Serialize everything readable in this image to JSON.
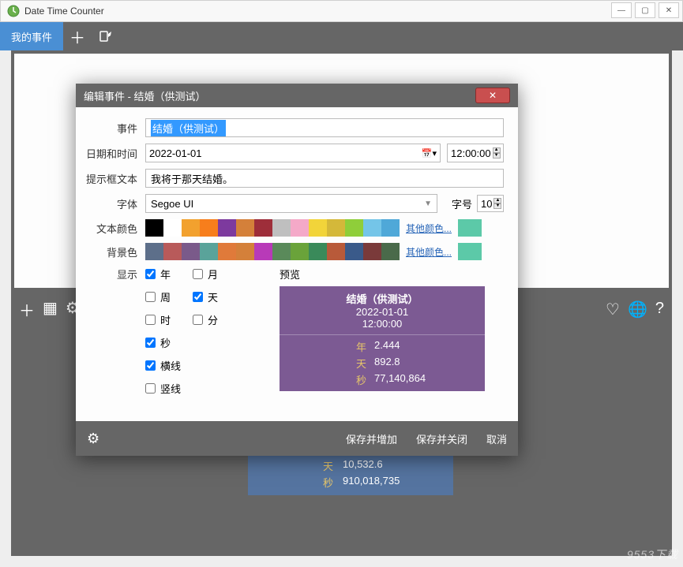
{
  "app": {
    "title": "Date Time Counter"
  },
  "toolbar": {
    "tab": "我的事件"
  },
  "bg_card": {
    "rows": [
      {
        "k": "天",
        "v": "10,532.6"
      },
      {
        "k": "秒",
        "v": "910,018,735"
      }
    ]
  },
  "modal": {
    "title": "编辑事件 - 结婚（供测试）",
    "labels": {
      "event": "事件",
      "datetime": "日期和时间",
      "tooltip": "提示框文本",
      "font": "字体",
      "fontsize": "字号",
      "textcolor": "文本颜色",
      "bgcolor": "背景色",
      "display": "显示",
      "preview": "预览",
      "more_color": "其他颜色...",
      "save_add": "保存并增加",
      "save_close": "保存并关闭",
      "cancel": "取消"
    },
    "values": {
      "event": "结婚（供测试）",
      "date": "2022-01-01",
      "time": "12:00:00",
      "tooltip": "我将于那天结婚。",
      "font": "Segoe UI",
      "size": "10"
    },
    "text_colors": [
      "#000000",
      "#ffffff",
      "#f2a12e",
      "#f77e1c",
      "#7d3a9e",
      "#d4803a",
      "#9e2e3a",
      "#bfbfbf",
      "#f4a9c8",
      "#f2d43a",
      "#d4b83a",
      "#8fce3a",
      "#74c5e8",
      "#4fa8d8"
    ],
    "bg_colors": [
      "#5d6f8a",
      "#b85a5a",
      "#7a5a8a",
      "#5aa39a",
      "#e07a3a",
      "#d4803a",
      "#b83ab8",
      "#5a8a5a",
      "#6aa33a",
      "#3a8a5a",
      "#b85a3a",
      "#3a5a8a",
      "#7a3a3a",
      "#4a6a4a"
    ],
    "current_text": "#5cc9a8",
    "current_bg": "#5cc9a8",
    "checks": {
      "year": "年",
      "month": "月",
      "week": "周",
      "day": "天",
      "hour": "时",
      "minute": "分",
      "second": "秒",
      "hline": "横线",
      "vline": "竖线"
    },
    "checked": {
      "year": true,
      "month": false,
      "week": false,
      "day": true,
      "hour": false,
      "minute": false,
      "second": true,
      "hline": true,
      "vline": false
    },
    "preview": {
      "title": "结婚（供测试）",
      "date": "2022-01-01",
      "time": "12:00:00",
      "rows": [
        {
          "k": "年",
          "v": "2.444"
        },
        {
          "k": "天",
          "v": "892.8"
        },
        {
          "k": "秒",
          "v": "77,140,864"
        }
      ]
    }
  },
  "watermark": "9553下载"
}
